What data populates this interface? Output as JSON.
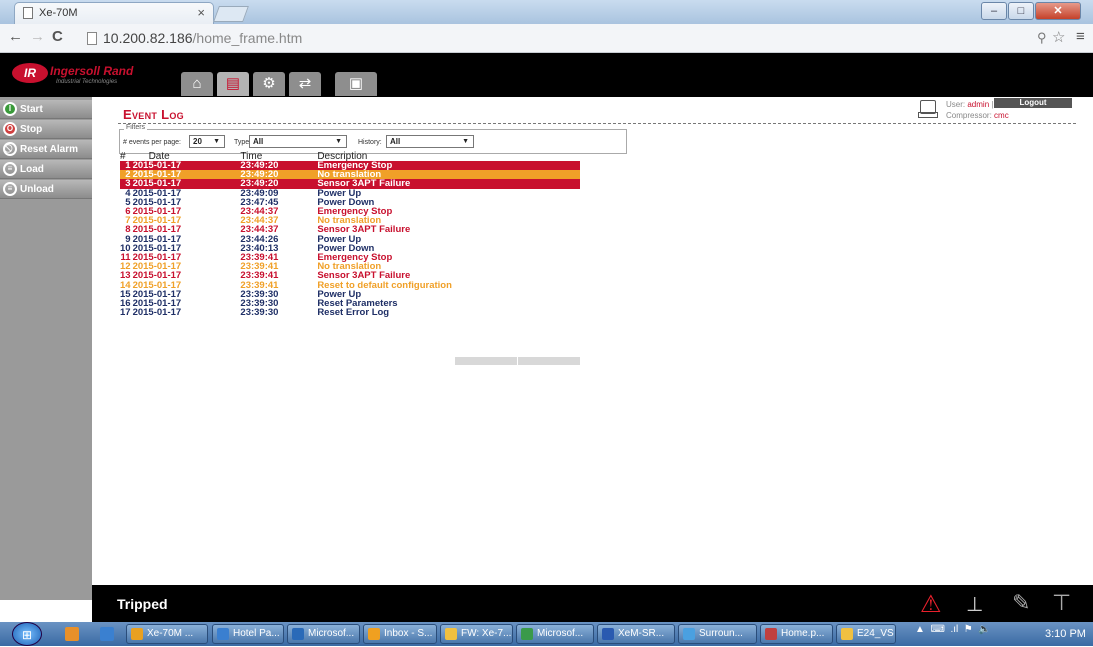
{
  "browser": {
    "tab_title": "Xe-70M",
    "tab_close": "×",
    "url_host": "10.200.82.186",
    "url_path": "/home_frame.htm"
  },
  "header": {
    "logo_text": "Ingersoll Rand",
    "logo_sub": "Industrial Technologies",
    "logo_mark": "IR",
    "nav_tabs": [
      "home-icon",
      "event-log-icon",
      "settings-icon",
      "io-icon",
      "info-icon"
    ]
  },
  "sidebar": {
    "items": [
      {
        "label": "Start"
      },
      {
        "label": "Stop"
      },
      {
        "label": "Reset Alarm"
      },
      {
        "label": "Load"
      },
      {
        "label": "Unload"
      }
    ]
  },
  "page": {
    "title": "Event Log",
    "user_label": "User:",
    "user_value": "admin",
    "user_sep": "|",
    "compressor_label": "Compressor:",
    "compressor_value": "cmc",
    "logout": "Logout"
  },
  "filters": {
    "legend": "Filters",
    "per_page_label": "# events per page:",
    "per_page_value": "20",
    "type_label": "Type:",
    "type_value": "All",
    "history_label": "History:",
    "history_value": "All"
  },
  "table": {
    "headers": [
      "#",
      "Date",
      "Time",
      "Description"
    ],
    "rows": [
      {
        "n": "1",
        "date": "2015-01-17",
        "time": "23:49:20",
        "desc": "Emergency Stop",
        "style": "hl-red"
      },
      {
        "n": "2",
        "date": "2015-01-17",
        "time": "23:49:20",
        "desc": "No translation",
        "style": "hl-orange"
      },
      {
        "n": "3",
        "date": "2015-01-17",
        "time": "23:49:20",
        "desc": "Sensor 3APT Failure",
        "style": "hl-red"
      },
      {
        "n": "4",
        "date": "2015-01-17",
        "time": "23:49:09",
        "desc": "Power Up",
        "style": "t-power"
      },
      {
        "n": "5",
        "date": "2015-01-17",
        "time": "23:47:45",
        "desc": "Power Down",
        "style": "t-power"
      },
      {
        "n": "6",
        "date": "2015-01-17",
        "time": "23:44:37",
        "desc": "Emergency Stop",
        "style": "t-red"
      },
      {
        "n": "7",
        "date": "2015-01-17",
        "time": "23:44:37",
        "desc": "No translation",
        "style": "t-orange"
      },
      {
        "n": "8",
        "date": "2015-01-17",
        "time": "23:44:37",
        "desc": "Sensor 3APT Failure",
        "style": "t-red"
      },
      {
        "n": "9",
        "date": "2015-01-17",
        "time": "23:44:26",
        "desc": "Power Up",
        "style": "t-power"
      },
      {
        "n": "10",
        "date": "2015-01-17",
        "time": "23:40:13",
        "desc": "Power Down",
        "style": "t-power"
      },
      {
        "n": "11",
        "date": "2015-01-17",
        "time": "23:39:41",
        "desc": "Emergency Stop",
        "style": "t-red"
      },
      {
        "n": "12",
        "date": "2015-01-17",
        "time": "23:39:41",
        "desc": "No translation",
        "style": "t-orange"
      },
      {
        "n": "13",
        "date": "2015-01-17",
        "time": "23:39:41",
        "desc": "Sensor 3APT Failure",
        "style": "t-red"
      },
      {
        "n": "14",
        "date": "2015-01-17",
        "time": "23:39:41",
        "desc": "Reset to default configuration",
        "style": "t-orange"
      },
      {
        "n": "15",
        "date": "2015-01-17",
        "time": "23:39:30",
        "desc": "Power Up",
        "style": "t-power"
      },
      {
        "n": "16",
        "date": "2015-01-17",
        "time": "23:39:30",
        "desc": "Reset Parameters",
        "style": "t-power"
      },
      {
        "n": "17",
        "date": "2015-01-17",
        "time": "23:39:30",
        "desc": "Reset Error Log",
        "style": "t-power"
      }
    ]
  },
  "statusbar": {
    "status": "Tripped",
    "icons": [
      "warning-icon",
      "network-icon",
      "service-icon",
      "compressor-icon"
    ]
  },
  "taskbar": {
    "items": [
      {
        "label": "Xe-70M ...",
        "color": "#e8a020"
      },
      {
        "label": "Hotel Pa...",
        "color": "#3a7fd0"
      },
      {
        "label": "Microsof...",
        "color": "#2a6ab8"
      },
      {
        "label": "Inbox - S...",
        "color": "#f0a020"
      },
      {
        "label": "FW: Xe-7...",
        "color": "#f0c040"
      },
      {
        "label": "Microsof...",
        "color": "#3a9a4a"
      },
      {
        "label": "XeM-SR...",
        "color": "#2a5ab0"
      },
      {
        "label": "Surroun...",
        "color": "#4aa0e0"
      },
      {
        "label": "Home.p...",
        "color": "#c04040"
      },
      {
        "label": "E24_VS",
        "color": "#f0c040"
      }
    ],
    "clock": "3:10 PM"
  },
  "colors": {
    "brand_red": "#c8102e",
    "alert_orange": "#f0a028",
    "power_blue": "#1f2f66"
  }
}
